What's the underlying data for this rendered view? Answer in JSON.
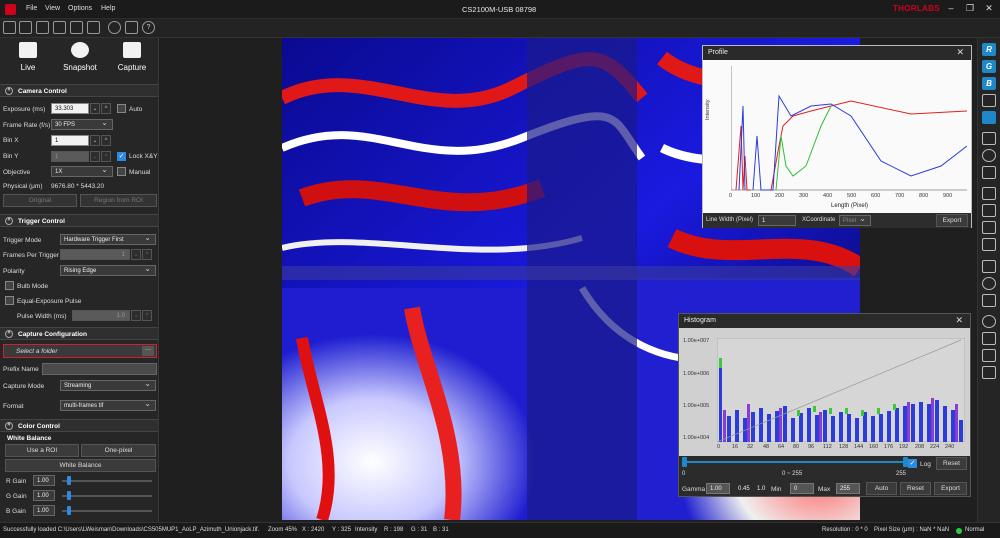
{
  "app": {
    "title": "CS2100M-USB 08798",
    "brand": "THORLABS",
    "menu": [
      "File",
      "View",
      "Options",
      "Help"
    ]
  },
  "acquisition": {
    "live": "Live",
    "snapshot": "Snapshot",
    "capture": "Capture"
  },
  "camera_control": {
    "title": "Camera Control",
    "exposure_label": "Exposure (ms)",
    "exposure_value": "33.303",
    "auto_label": "Auto",
    "frame_rate_label": "Frame Rate (f/s)",
    "frame_rate_value": "30 FPS",
    "bin_x_label": "Bin X",
    "bin_x_value": "1",
    "bin_y_label": "Bin Y",
    "bin_y_value": "1",
    "lock_label": "Lock X&Y",
    "objective_label": "Objective",
    "objective_value": "1X",
    "manual_label": "Manual",
    "physical_label": "Physical (μm)",
    "physical_value": "9676.80 * 5443.20",
    "original_button": "Original",
    "region_button": "Region from ROI"
  },
  "trigger_control": {
    "title": "Trigger Control",
    "mode_label": "Trigger Mode",
    "mode_value": "Hardware Trigger First",
    "frames_label": "Frames Per Trigger",
    "frames_value": "1",
    "polarity_label": "Polarity",
    "polarity_value": "Rising Edge",
    "bulb_label": "Bulb Mode",
    "equal_label": "Equal-Exposure Pulse",
    "pulse_label": "Pulse Width (ms)",
    "pulse_value": "1.0"
  },
  "capture_config": {
    "title": "Capture Configuration",
    "folder_placeholder": "Select a folder",
    "browse": "···",
    "prefix_label": "Prefix Name",
    "mode_label": "Capture Mode",
    "mode_value": "Streaming",
    "format_label": "Format",
    "format_value": "multi-frames tif"
  },
  "color_control": {
    "title": "Color Control",
    "wb_label": "White Balance",
    "use_roi": "Use a ROI",
    "one_pixel": "One-pixel",
    "white_balance": "White Balance",
    "gains": [
      {
        "label": "R Gain",
        "value": "1.00"
      },
      {
        "label": "G Gain",
        "value": "1.00"
      },
      {
        "label": "B Gain",
        "value": "1.00"
      }
    ]
  },
  "profile": {
    "title": "Profile",
    "ylabel": "Intensity",
    "xlabel": "Length (Pixel)",
    "x_ticks": [
      "0",
      "100",
      "200",
      "300",
      "400",
      "500",
      "600",
      "700",
      "800",
      "900"
    ],
    "line_width_label": "Line Width (Pixel)",
    "line_width_value": "1",
    "xcoord_label": "XCoordinate",
    "xcoord_value": "Pixel",
    "export": "Export"
  },
  "histogram": {
    "title": "Histogram",
    "y_ticks": [
      "1.00e+007",
      "1.00e+006",
      "1.00e+005",
      "1.00e+004"
    ],
    "x_ticks": [
      "0",
      "16",
      "32",
      "48",
      "64",
      "80",
      "96",
      "112",
      "128",
      "144",
      "160",
      "176",
      "192",
      "208",
      "224",
      "240"
    ],
    "range_min": "0",
    "range_text": "0 ~ 255",
    "range_max": "255",
    "log_label": "Log",
    "reset": "Reset",
    "gamma_label": "Gamma",
    "gamma_value": "1.00",
    "gamma_max": "0.45",
    "gamma_step": "1.0",
    "min_label": "Min",
    "min_value": "0",
    "max_label": "Max",
    "max_value": "255",
    "auto": "Auto",
    "reset2": "Reset",
    "export": "Export"
  },
  "right_toolbar": {
    "r": "R",
    "g": "G",
    "b": "B"
  },
  "status": {
    "message": "Successfully loaded C:\\Users\\LWeisman\\Downloads\\CS505MUP1_AoLP_Azimuth_Unionjack.tif.",
    "zoom": "Zoom 45%",
    "x": "X : 2420",
    "y": "Y : 325",
    "intensity": "Intensity",
    "r": "R : 198",
    "g": "G : 31",
    "b": "B : 31",
    "resolution": "Resolution : 0 * 0",
    "pixel_size": "Pixel Size (μm) : NaN * NaN",
    "mode": "Normal"
  },
  "colors": {
    "accent": "#1e88c8",
    "red": "#e02020",
    "green": "#3cc83c",
    "blue": "#2a3cdc"
  }
}
